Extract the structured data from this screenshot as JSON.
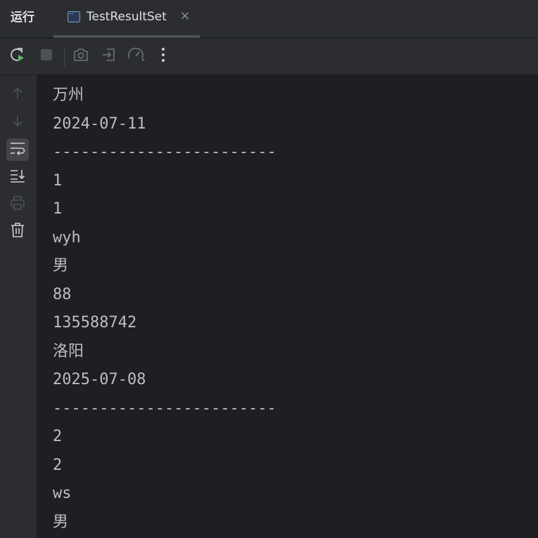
{
  "header": {
    "panel_title": "运行",
    "tab": {
      "label": "TestResultSet",
      "icon": "console-window-icon",
      "close": "×"
    }
  },
  "toolbar": {
    "buttons": [
      {
        "name": "rerun-icon"
      },
      {
        "name": "stop-icon"
      },
      {
        "name": "camera-icon"
      },
      {
        "name": "exit-icon"
      },
      {
        "name": "gauge-icon"
      },
      {
        "name": "more-icon"
      }
    ]
  },
  "gutter": {
    "buttons": [
      {
        "name": "arrow-up-icon"
      },
      {
        "name": "arrow-down-icon"
      },
      {
        "name": "soft-wrap-icon"
      },
      {
        "name": "scroll-to-end-icon"
      },
      {
        "name": "print-icon"
      },
      {
        "name": "trash-icon"
      }
    ]
  },
  "console": {
    "lines": [
      "万州",
      "2024-07-11",
      "------------------------",
      "1",
      "1",
      "wyh",
      "男",
      "88",
      "135588742",
      "洛阳",
      "2025-07-08",
      "------------------------",
      "2",
      "2",
      "ws",
      "男"
    ]
  },
  "colors": {
    "background": "#1e1f22",
    "panel": "#2b2d30",
    "text": "#bcbec4",
    "icon": "#8b8e94",
    "icon_disabled": "#4e5157",
    "run_green": "#5fb865"
  }
}
